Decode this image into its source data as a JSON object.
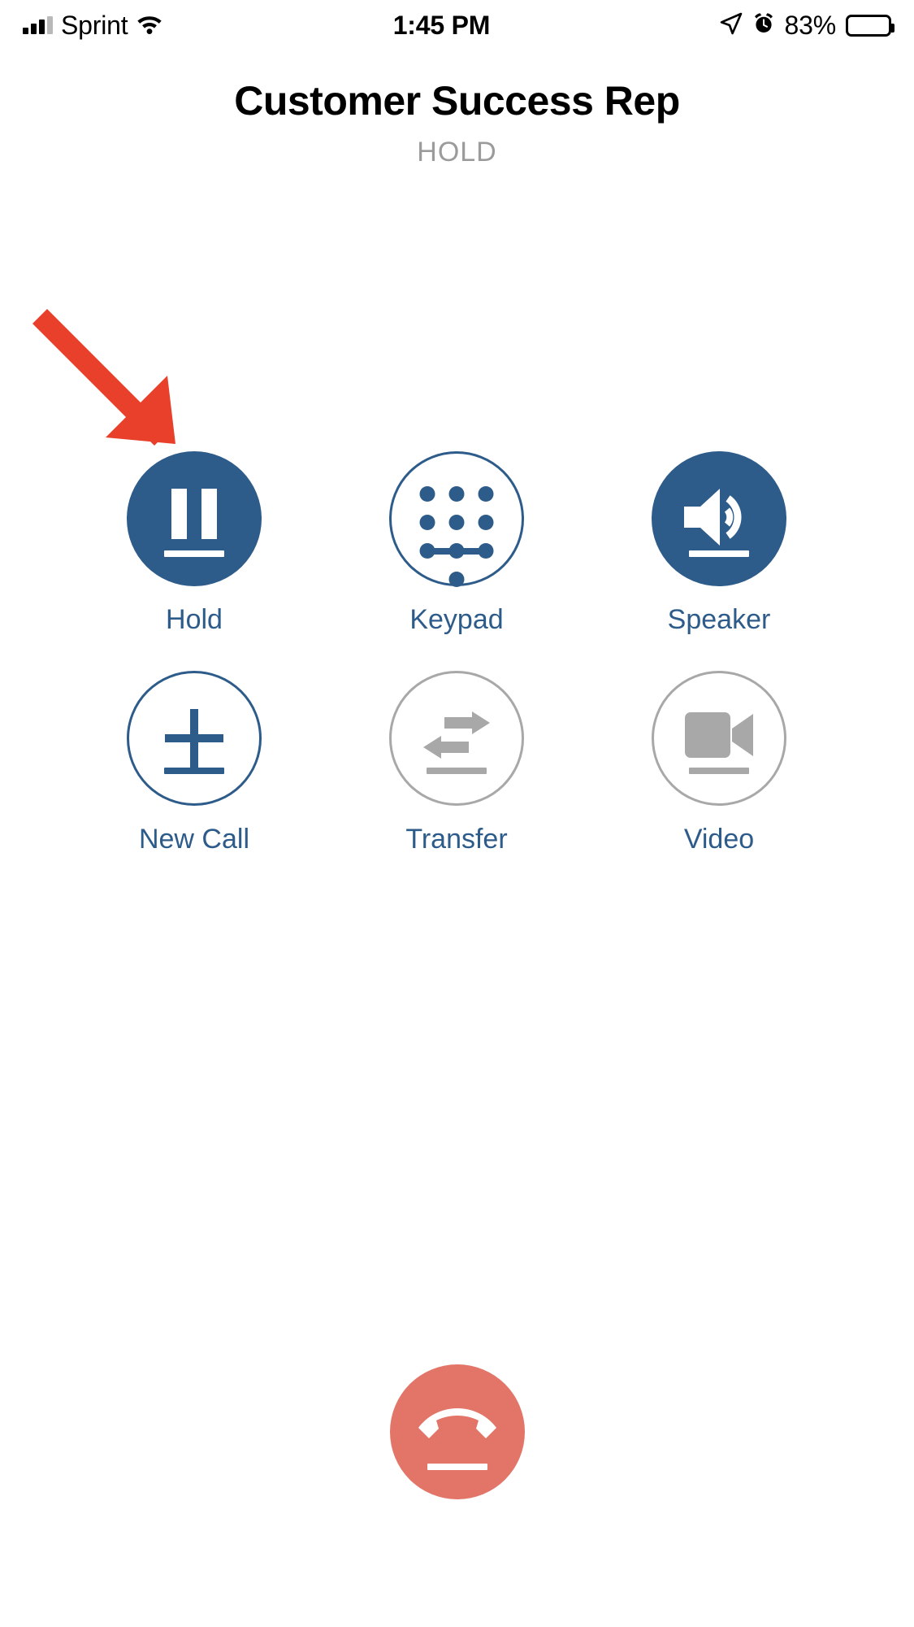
{
  "status_bar": {
    "carrier": "Sprint",
    "time": "1:45 PM",
    "battery_percent": "83%",
    "icons": {
      "signal": "signal-bars-icon",
      "wifi": "wifi-icon",
      "location": "location-arrow-icon",
      "alarm": "alarm-clock-icon",
      "battery": "battery-icon"
    }
  },
  "header": {
    "caller_name": "Customer Success Rep",
    "call_status": "HOLD"
  },
  "actions": [
    {
      "label": "Hold",
      "icon": "pause-icon",
      "state": "active",
      "style": "filled"
    },
    {
      "label": "Keypad",
      "icon": "keypad-icon",
      "state": "enabled",
      "style": "outline"
    },
    {
      "label": "Speaker",
      "icon": "speaker-icon",
      "state": "active",
      "style": "filled"
    },
    {
      "label": "New Call",
      "icon": "plus-icon",
      "state": "enabled",
      "style": "outline"
    },
    {
      "label": "Transfer",
      "icon": "transfer-icon",
      "state": "disabled",
      "style": "outline-muted"
    },
    {
      "label": "Video",
      "icon": "video-camera-icon",
      "state": "disabled",
      "style": "outline-muted"
    }
  ],
  "end_call": {
    "icon": "hangup-phone-icon",
    "label": ""
  },
  "annotation": {
    "type": "arrow",
    "points_to": "Hold",
    "color": "#e8402a"
  },
  "colors": {
    "accent_blue": "#2d5b8a",
    "disabled_gray": "#a8a8a8",
    "end_call_red": "#e27567",
    "status_text_gray": "#9b9b9b",
    "annotation_red": "#e8402a",
    "background": "#ffffff"
  }
}
